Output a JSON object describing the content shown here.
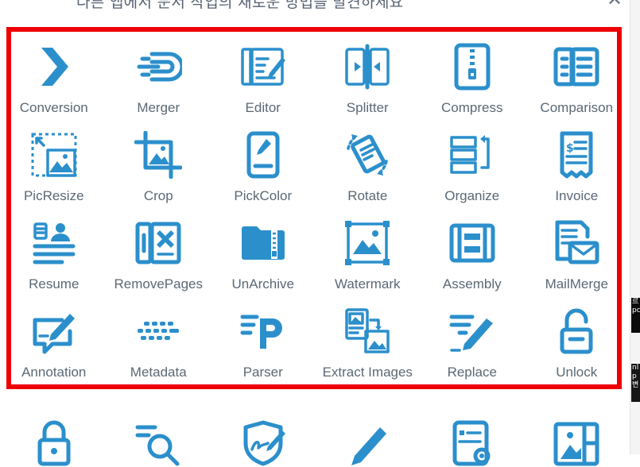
{
  "header": {
    "title": "다른 앱에서 문서 작업의 새로운 방법을 발견하세요",
    "close_label": "✕"
  },
  "side_chips": [
    {
      "text": "르 pc"
    },
    {
      "text": "nl p 변"
    }
  ],
  "colors": {
    "icon": "#2b8fcc",
    "highlight": "#ee0000",
    "label": "#5b6874"
  },
  "apps": [
    {
      "label": "Conversion",
      "icon": "chevron-right-icon"
    },
    {
      "label": "Merger",
      "icon": "merge-icon"
    },
    {
      "label": "Editor",
      "icon": "edit-document-icon"
    },
    {
      "label": "Splitter",
      "icon": "split-icon"
    },
    {
      "label": "Compress",
      "icon": "zip-file-icon"
    },
    {
      "label": "Comparison",
      "icon": "compare-icon"
    },
    {
      "label": "PicResize",
      "icon": "image-resize-icon"
    },
    {
      "label": "Crop",
      "icon": "crop-icon"
    },
    {
      "label": "PickColor",
      "icon": "color-picker-icon"
    },
    {
      "label": "Rotate",
      "icon": "rotate-icon"
    },
    {
      "label": "Organize",
      "icon": "organize-icon"
    },
    {
      "label": "Invoice",
      "icon": "invoice-icon"
    },
    {
      "label": "Resume",
      "icon": "resume-icon"
    },
    {
      "label": "RemovePages",
      "icon": "remove-pages-icon"
    },
    {
      "label": "UnArchive",
      "icon": "folder-archive-icon"
    },
    {
      "label": "Watermark",
      "icon": "watermark-icon"
    },
    {
      "label": "Assembly",
      "icon": "assembly-icon"
    },
    {
      "label": "MailMerge",
      "icon": "mail-merge-icon"
    },
    {
      "label": "Annotation",
      "icon": "annotation-icon"
    },
    {
      "label": "Metadata",
      "icon": "metadata-icon"
    },
    {
      "label": "Parser",
      "icon": "parser-icon"
    },
    {
      "label": "Extract Images",
      "icon": "extract-images-icon"
    },
    {
      "label": "Replace",
      "icon": "replace-icon"
    },
    {
      "label": "Unlock",
      "icon": "unlock-icon"
    }
  ],
  "more_apps": [
    {
      "icon": "lock-icon"
    },
    {
      "icon": "search-icon"
    },
    {
      "icon": "signature-icon"
    },
    {
      "icon": "pen-icon"
    },
    {
      "icon": "document-settings-icon"
    },
    {
      "icon": "image-gallery-icon"
    }
  ]
}
